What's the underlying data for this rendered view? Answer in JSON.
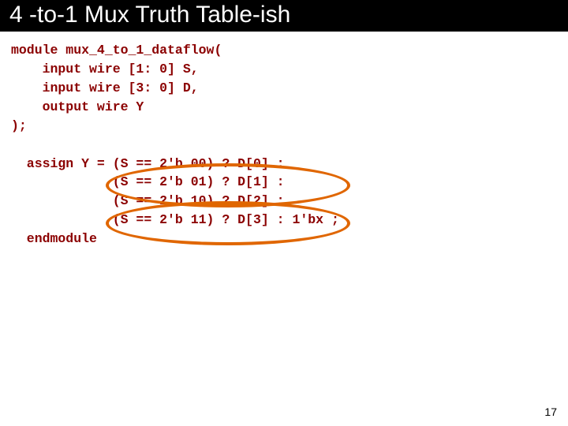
{
  "title": "4 -to-1 Mux Truth Table-ish",
  "code": {
    "l1": "module mux_4_to_1_dataflow(",
    "l2": "    input wire [1: 0] S,",
    "l3": "    input wire [3: 0] D,",
    "l4": "    output wire Y",
    "l5": ");",
    "l6": "",
    "l7": "  assign Y = (S == 2'b 00) ? D[0] :",
    "l8": "             (S == 2'b 01) ? D[1] :",
    "l9": "             (S == 2'b 10) ? D[2] :",
    "l10": "             (S == 2'b 11) ? D[3] : 1'bx ;",
    "l11": "  endmodule"
  },
  "page_number": "17"
}
